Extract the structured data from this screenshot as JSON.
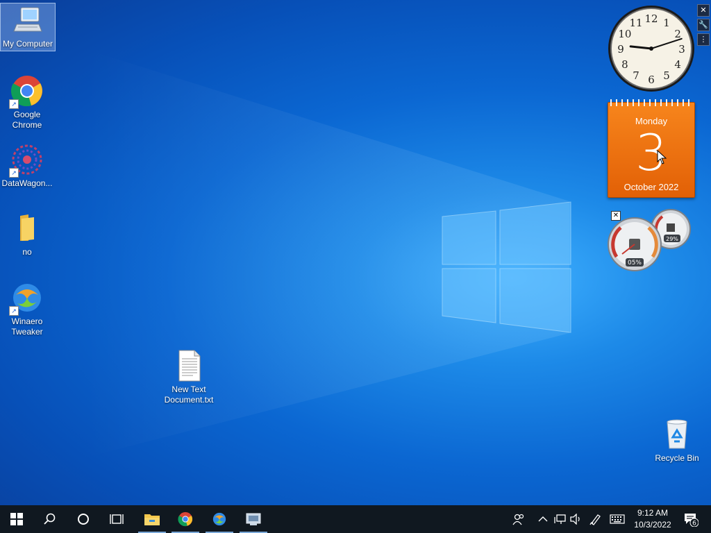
{
  "desktop_icons": [
    {
      "label": "My Computer"
    },
    {
      "label": "Google Chrome"
    },
    {
      "label": "DataWagon..."
    },
    {
      "label": "no"
    },
    {
      "label": "Winaero Tweaker"
    },
    {
      "label": "New Text Document.txt"
    },
    {
      "label": "Recycle Bin"
    }
  ],
  "clock_gadget": {
    "numerals": [
      "12",
      "1",
      "2",
      "3",
      "4",
      "5",
      "6",
      "7",
      "8",
      "9",
      "10",
      "11"
    ],
    "hour": 9,
    "minute": 12
  },
  "calendar_gadget": {
    "weekday": "Monday",
    "day": "3",
    "month_year": "October 2022"
  },
  "cpu_meter": {
    "cpu": "05%",
    "memory": "29%"
  },
  "gadget_tools": {
    "close": "✕",
    "settings": "🔧",
    "drag": "⋮"
  },
  "meter_close": "✕",
  "taskbar": {
    "time": "9:12 AM",
    "date": "10/3/2022",
    "notifications_count": "6"
  },
  "colors": {
    "taskbar": "#101820",
    "calendar": "#ef6f10",
    "accent": "#0b67d2"
  }
}
